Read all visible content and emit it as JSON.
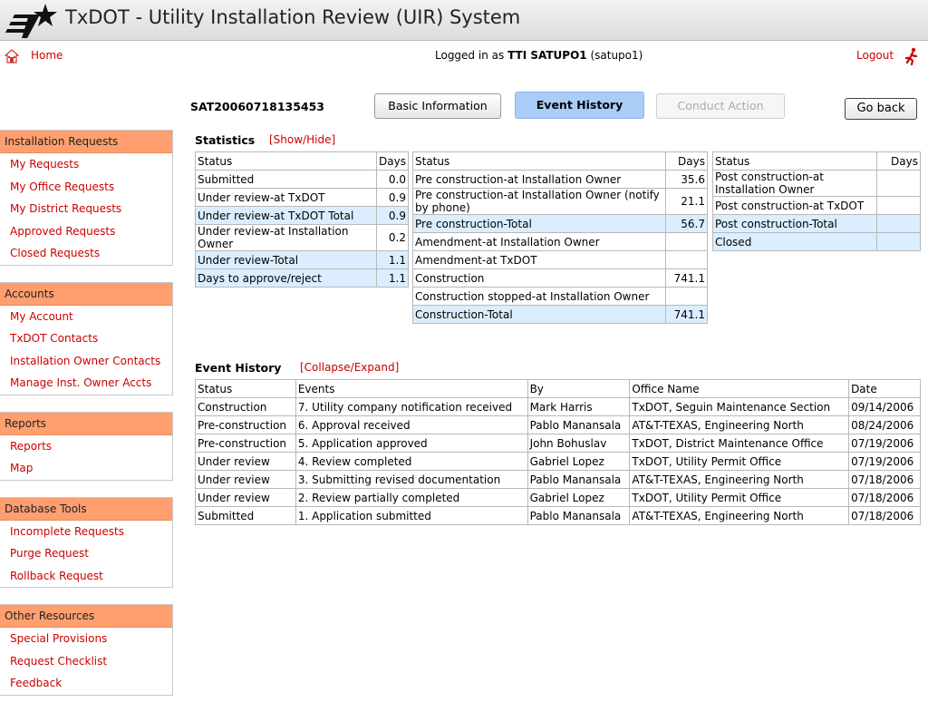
{
  "header": {
    "title": "TxDOT - Utility Installation Review (UIR) System"
  },
  "topbar": {
    "home_label": "Home",
    "logged_prefix": "Logged in as",
    "user_name": "TTI SATUPO1",
    "user_id": "(satupo1)",
    "logout_label": "Logout"
  },
  "sidebar": {
    "groups": [
      {
        "title": "Installation Requests",
        "items": [
          "My Requests",
          "My Office Requests",
          "My District Requests",
          "Approved Requests",
          "Closed Requests"
        ]
      },
      {
        "title": "Accounts",
        "items": [
          "My Account",
          "TxDOT Contacts",
          "Installation Owner Contacts",
          "Manage Inst. Owner Accts"
        ]
      },
      {
        "title": "Reports",
        "items": [
          "Reports",
          "Map"
        ]
      },
      {
        "title": "Database Tools",
        "items": [
          "Incomplete Requests",
          "Purge Request",
          "Rollback Request"
        ]
      },
      {
        "title": "Other Resources",
        "items": [
          "Special Provisions",
          "Request Checklist",
          "Feedback"
        ]
      }
    ]
  },
  "record": {
    "id": "SAT20060718135453",
    "buttons": {
      "basic": "Basic Information",
      "event": "Event History",
      "conduct": "Conduct Action",
      "back": "Go back"
    }
  },
  "statistics": {
    "title": "Statistics",
    "toggle": "[Show/Hide]",
    "col_status": "Status",
    "col_days": "Days",
    "table1": [
      {
        "status": "Submitted",
        "days": "0.0",
        "hl": false
      },
      {
        "status": "Under review-at TxDOT",
        "days": "0.9",
        "hl": false
      },
      {
        "status": "Under review-at TxDOT Total",
        "days": "0.9",
        "hl": true
      },
      {
        "status": "Under review-at Installation Owner",
        "days": "0.2",
        "hl": false
      },
      {
        "status": "Under review-Total",
        "days": "1.1",
        "hl": true
      },
      {
        "status": "Days to approve/reject",
        "days": "1.1",
        "hl": true
      }
    ],
    "table2": [
      {
        "status": "Pre construction-at Installation Owner",
        "days": "35.6",
        "hl": false
      },
      {
        "status": "Pre construction-at Installation Owner (notify by phone)",
        "days": "21.1",
        "hl": false
      },
      {
        "status": "Pre construction-Total",
        "days": "56.7",
        "hl": true
      },
      {
        "status": "Amendment-at Installation Owner",
        "days": "",
        "hl": false
      },
      {
        "status": "Amendment-at TxDOT",
        "days": "",
        "hl": false
      },
      {
        "status": "Construction",
        "days": "741.1",
        "hl": false
      },
      {
        "status": "Construction stopped-at Installation Owner",
        "days": "",
        "hl": false
      },
      {
        "status": "Construction-Total",
        "days": "741.1",
        "hl": true
      }
    ],
    "table3": [
      {
        "status": "Post construction-at Installation Owner",
        "days": "",
        "hl": false
      },
      {
        "status": "Post construction-at TxDOT",
        "days": "",
        "hl": false
      },
      {
        "status": "Post construction-Total",
        "days": "",
        "hl": true
      },
      {
        "status": "Closed",
        "days": "",
        "hl": true
      }
    ]
  },
  "event_history": {
    "title": "Event History",
    "toggle": "[Collapse/Expand]",
    "columns": [
      "Status",
      "Events",
      "By",
      "Office Name",
      "Date"
    ],
    "rows": [
      [
        "Construction",
        "7. Utility company notification received",
        "Mark Harris",
        "TxDOT, Seguin Maintenance Section",
        "09/14/2006"
      ],
      [
        "Pre-construction",
        "6. Approval received",
        "Pablo Manansala",
        "AT&T-TEXAS, Engineering North",
        "08/24/2006"
      ],
      [
        "Pre-construction",
        "5. Application approved",
        "John Bohuslav",
        "TxDOT, District Maintenance Office",
        "07/19/2006"
      ],
      [
        "Under review",
        "4. Review completed",
        "Gabriel Lopez",
        "TxDOT, Utility Permit Office",
        "07/19/2006"
      ],
      [
        "Under review",
        "3. Submitting revised documentation",
        "Pablo Manansala",
        "AT&T-TEXAS, Engineering North",
        "07/18/2006"
      ],
      [
        "Under review",
        "2. Review partially completed",
        "Gabriel Lopez",
        "TxDOT, Utility Permit Office",
        "07/18/2006"
      ],
      [
        "Submitted",
        "1. Application submitted",
        "Pablo Manansala",
        "AT&T-TEXAS, Engineering North",
        "07/18/2006"
      ]
    ]
  },
  "colors": {
    "accent": "#ff9f6f",
    "link": "#cc0000",
    "highlight": "#dbeeff",
    "active_button": "#a9cdf6"
  },
  "icons": {
    "home": "home-icon",
    "logout": "running-man-icon",
    "logo": "txdot-star-logo"
  }
}
